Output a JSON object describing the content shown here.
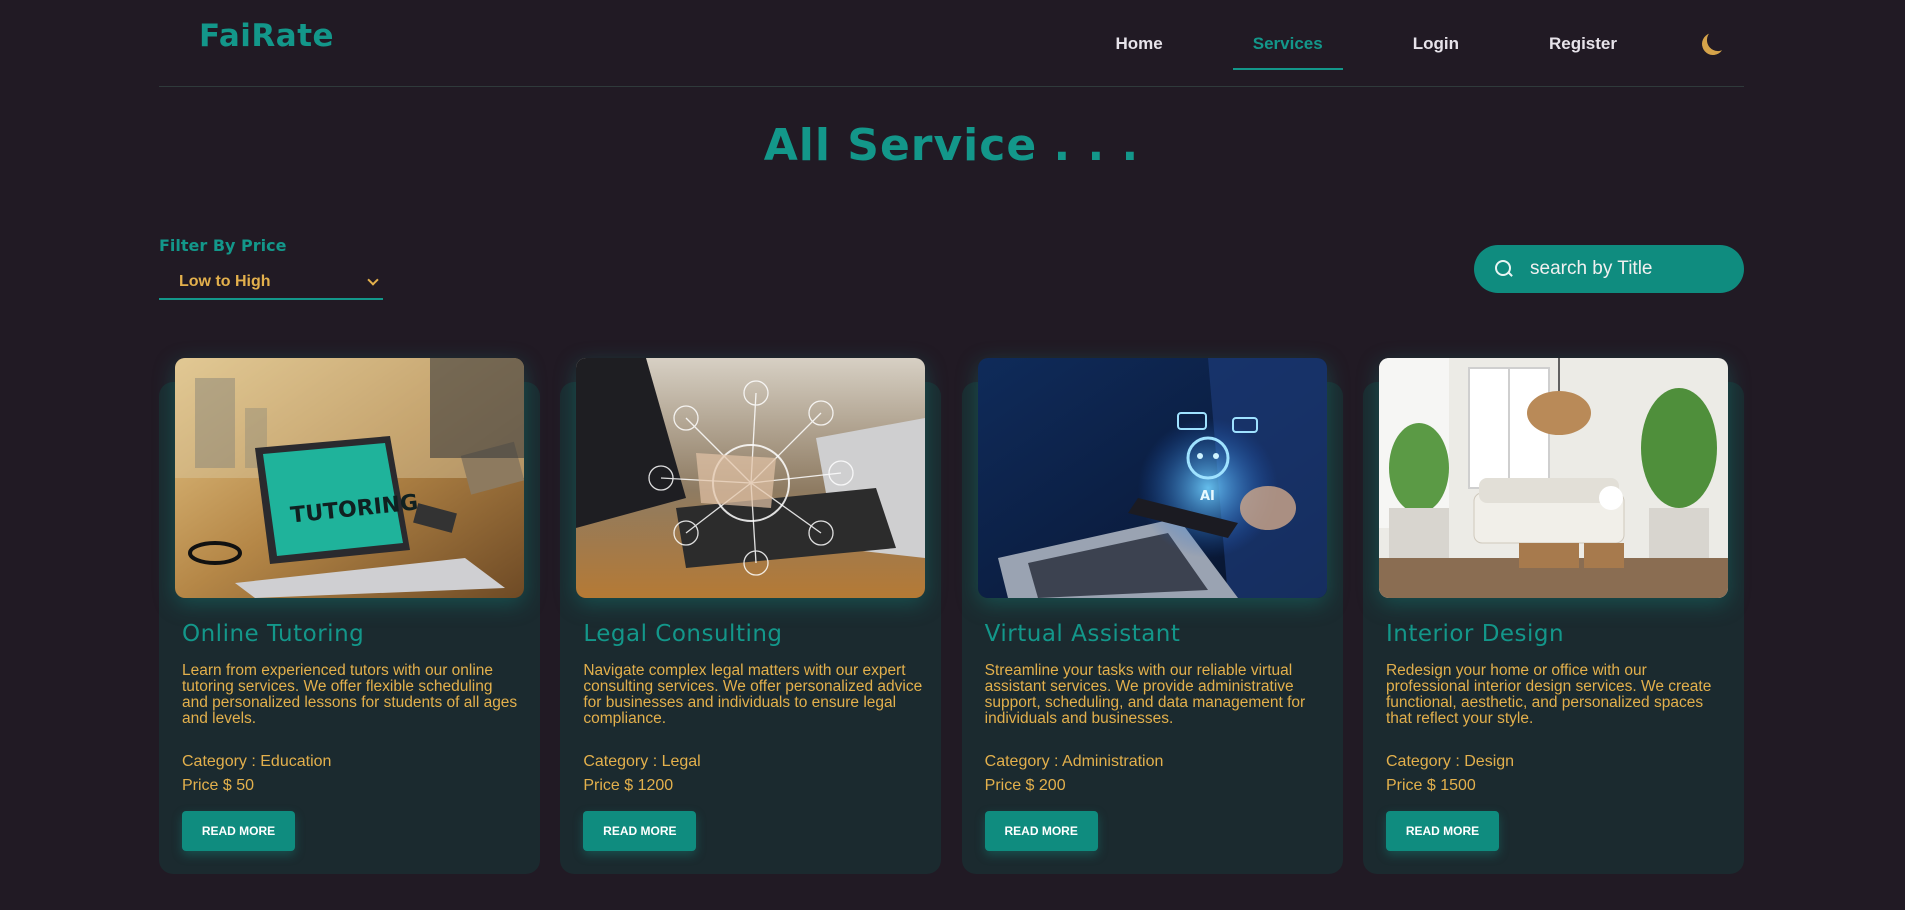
{
  "brand": {
    "logo": "FaiRate",
    "accent": "#13978a",
    "highlight": "#e3b04c",
    "background": "#211a24"
  },
  "nav": {
    "items": [
      {
        "label": "Home"
      },
      {
        "label": "Services",
        "active": true
      },
      {
        "label": "Login"
      },
      {
        "label": "Register"
      }
    ],
    "theme_icon": "moon-icon"
  },
  "page": {
    "title": "All Service . . ."
  },
  "filter": {
    "label": "Filter By Price",
    "selected": "Low to High"
  },
  "search": {
    "placeholder": "search by Title",
    "value": ""
  },
  "services": [
    {
      "title": "Online Tutoring",
      "description": "Learn from experienced tutors with our online tutoring services. We offer flexible scheduling and personalized lessons for students of all ages and levels.",
      "category": "Category : Education",
      "price": "Price $ 50",
      "button": "READ MORE",
      "image_overlay_text": "TUTORING"
    },
    {
      "title": "Legal Consulting",
      "description": "Navigate complex legal matters with our expert consulting services. We offer personalized advice for businesses and individuals to ensure legal compliance.",
      "category": "Category : Legal",
      "price": "Price $ 1200",
      "button": "READ MORE"
    },
    {
      "title": "Virtual Assistant",
      "description": "Streamline your tasks with our reliable virtual assistant services. We provide administrative support, scheduling, and data management for individuals and businesses.",
      "category": "Category : Administration",
      "price": "Price $ 200",
      "button": "READ MORE",
      "image_overlay_text": "AI"
    },
    {
      "title": "Interior Design",
      "description": "Redesign your home or office with our professional interior design services. We create functional, aesthetic, and personalized spaces that reflect your style.",
      "category": "Category : Design",
      "price": "Price $ 1500",
      "button": "READ MORE"
    }
  ]
}
